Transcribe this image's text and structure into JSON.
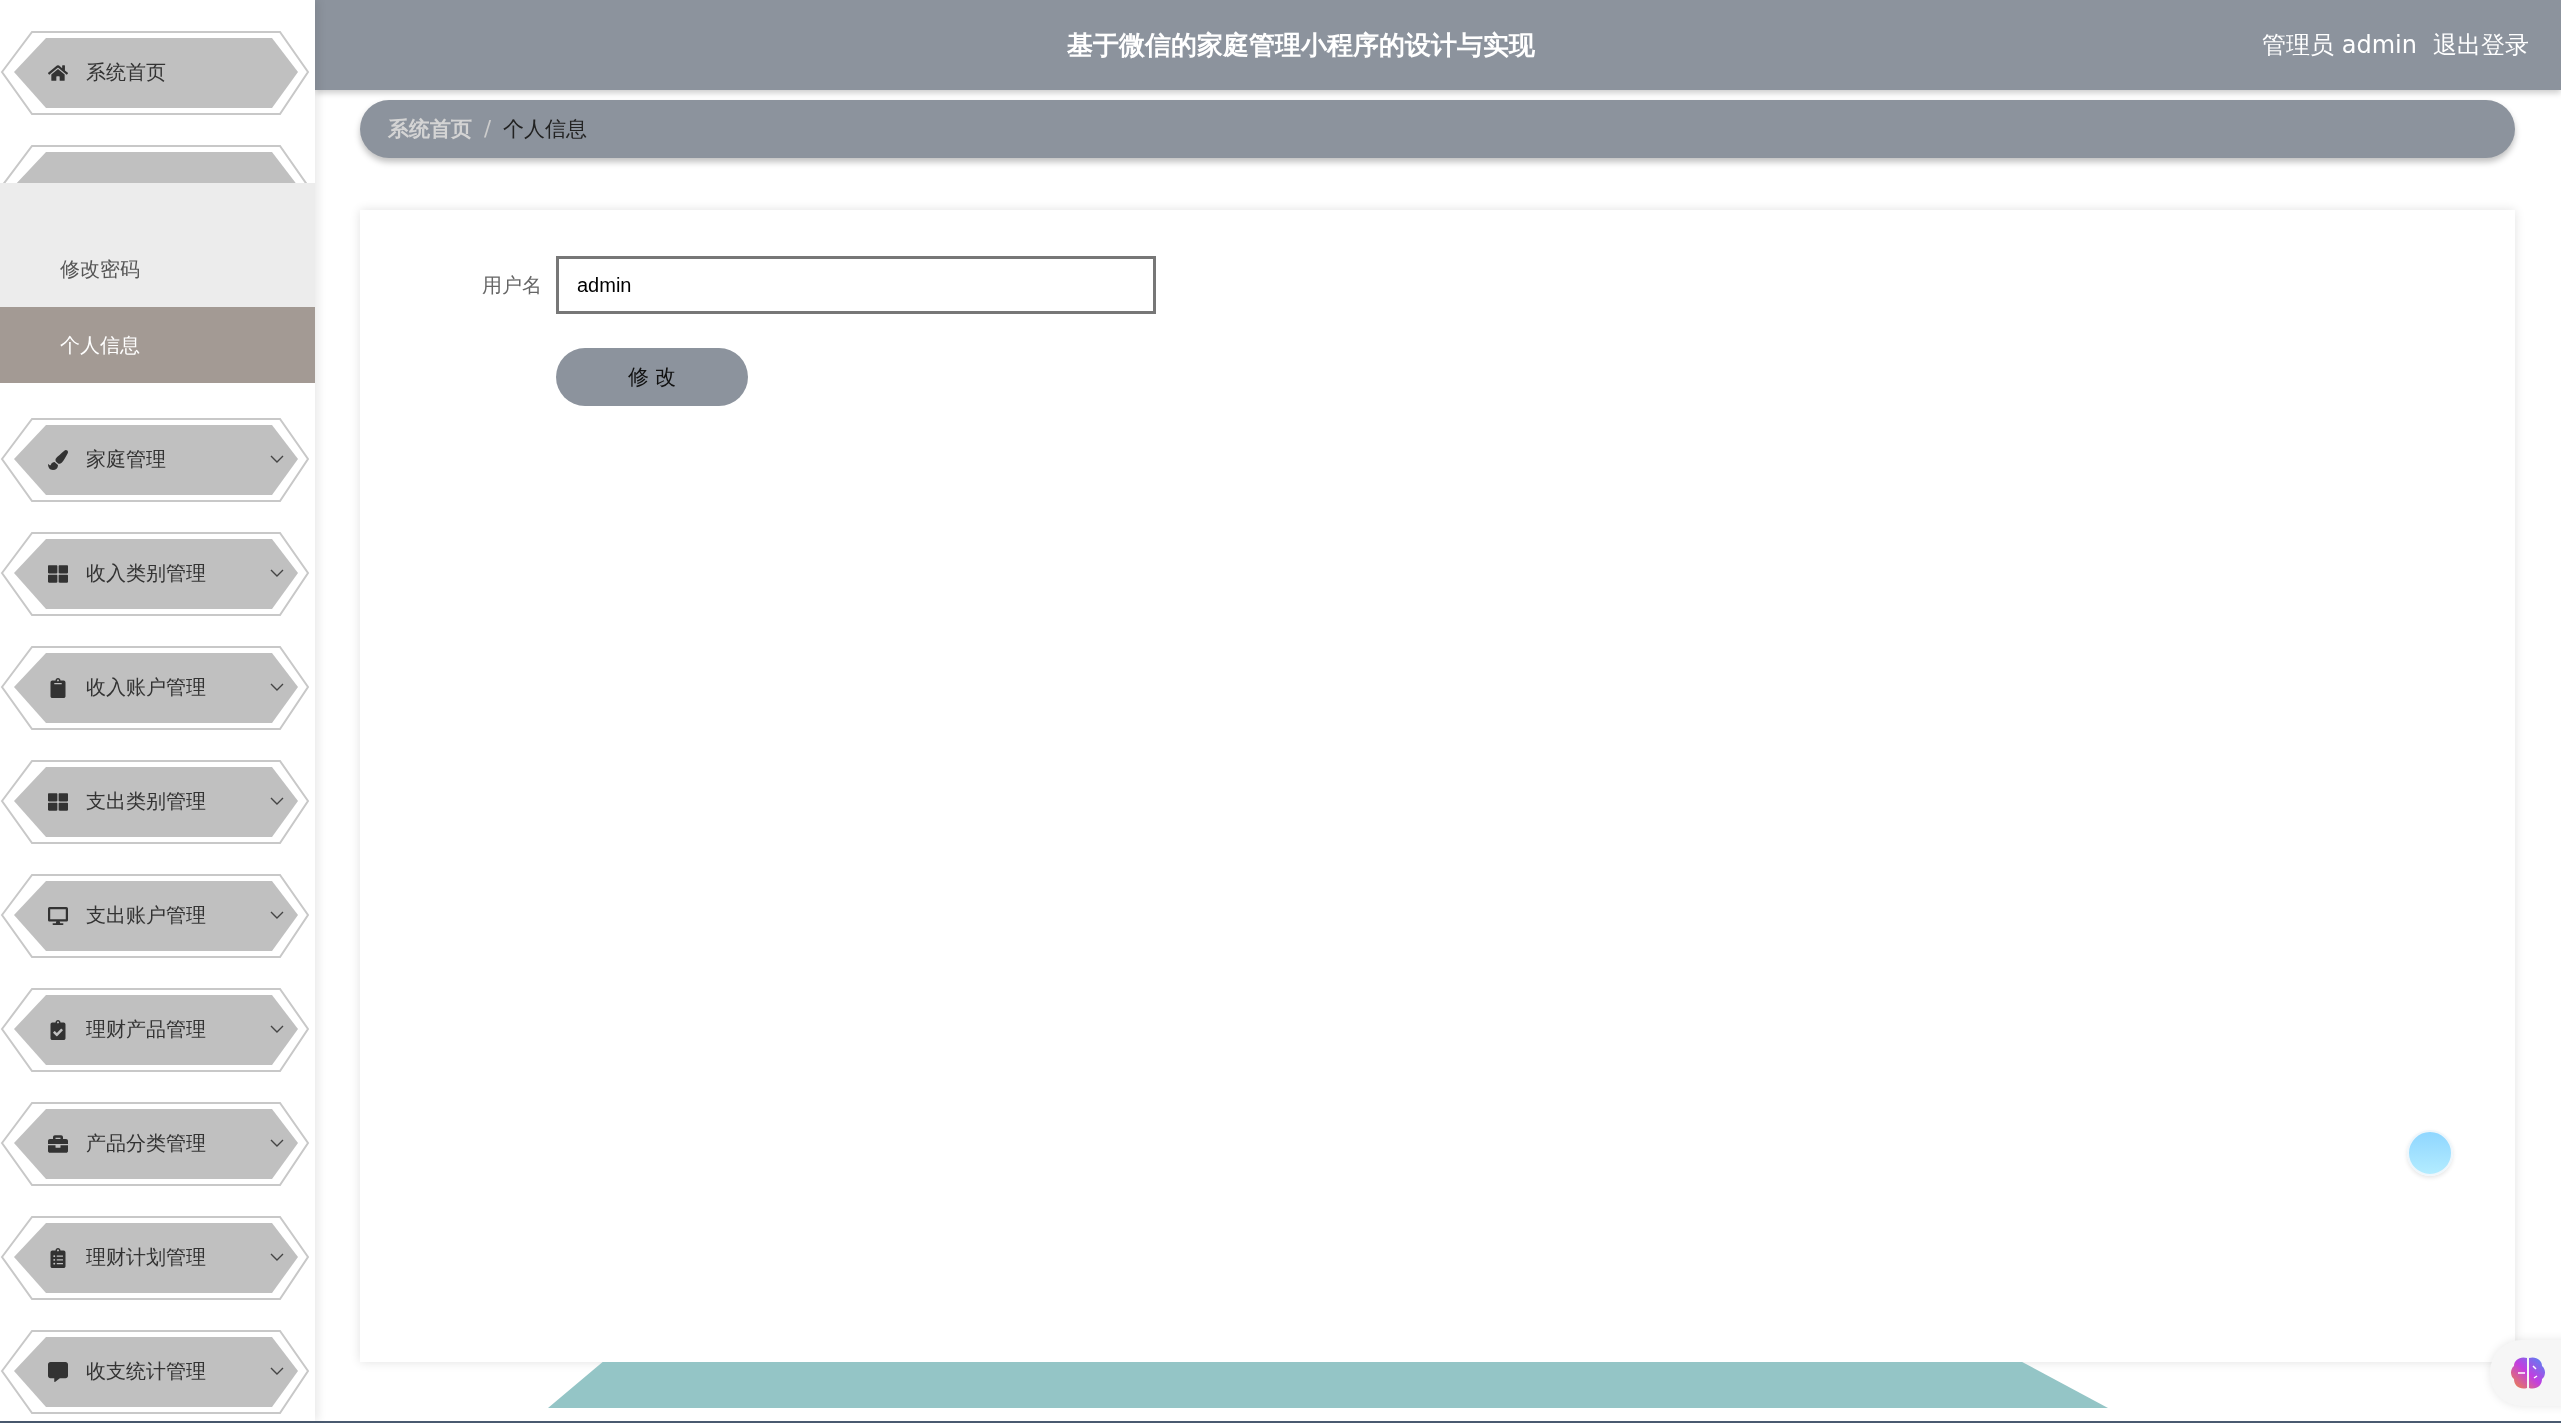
{
  "sidebar": {
    "items": [
      {
        "label": "系统首页",
        "kind": "link"
      },
      {
        "kind": "menu",
        "expanded": true,
        "children": [
          {
            "label": "修改密码",
            "selected": false
          },
          {
            "label": "个人信息",
            "selected": true
          }
        ]
      },
      {
        "label": "家庭管理",
        "kind": "menu",
        "expanded": false
      },
      {
        "label": "收入类别管理",
        "kind": "menu",
        "expanded": false
      },
      {
        "label": "收入账户管理",
        "kind": "menu",
        "expanded": false
      },
      {
        "label": "支出类别管理",
        "kind": "menu",
        "expanded": false
      },
      {
        "label": "支出账户管理",
        "kind": "menu",
        "expanded": false
      },
      {
        "label": "理财产品管理",
        "kind": "menu",
        "expanded": false
      },
      {
        "label": "产品分类管理",
        "kind": "menu",
        "expanded": false
      },
      {
        "label": "理财计划管理",
        "kind": "menu",
        "expanded": false
      },
      {
        "label": "收支统计管理",
        "kind": "menu",
        "expanded": false
      }
    ]
  },
  "header": {
    "title": "基于微信的家庭管理小程序的设计与实现",
    "user": "管理员 admin",
    "logout": "退出登录"
  },
  "breadcrumb": {
    "separator": "/",
    "items": [
      {
        "label": "系统首页",
        "current": false
      },
      {
        "label": "个人信息",
        "current": true
      }
    ]
  },
  "form": {
    "fields": [
      {
        "label": "用户名",
        "value": "admin"
      }
    ],
    "submit": "修 改"
  }
}
